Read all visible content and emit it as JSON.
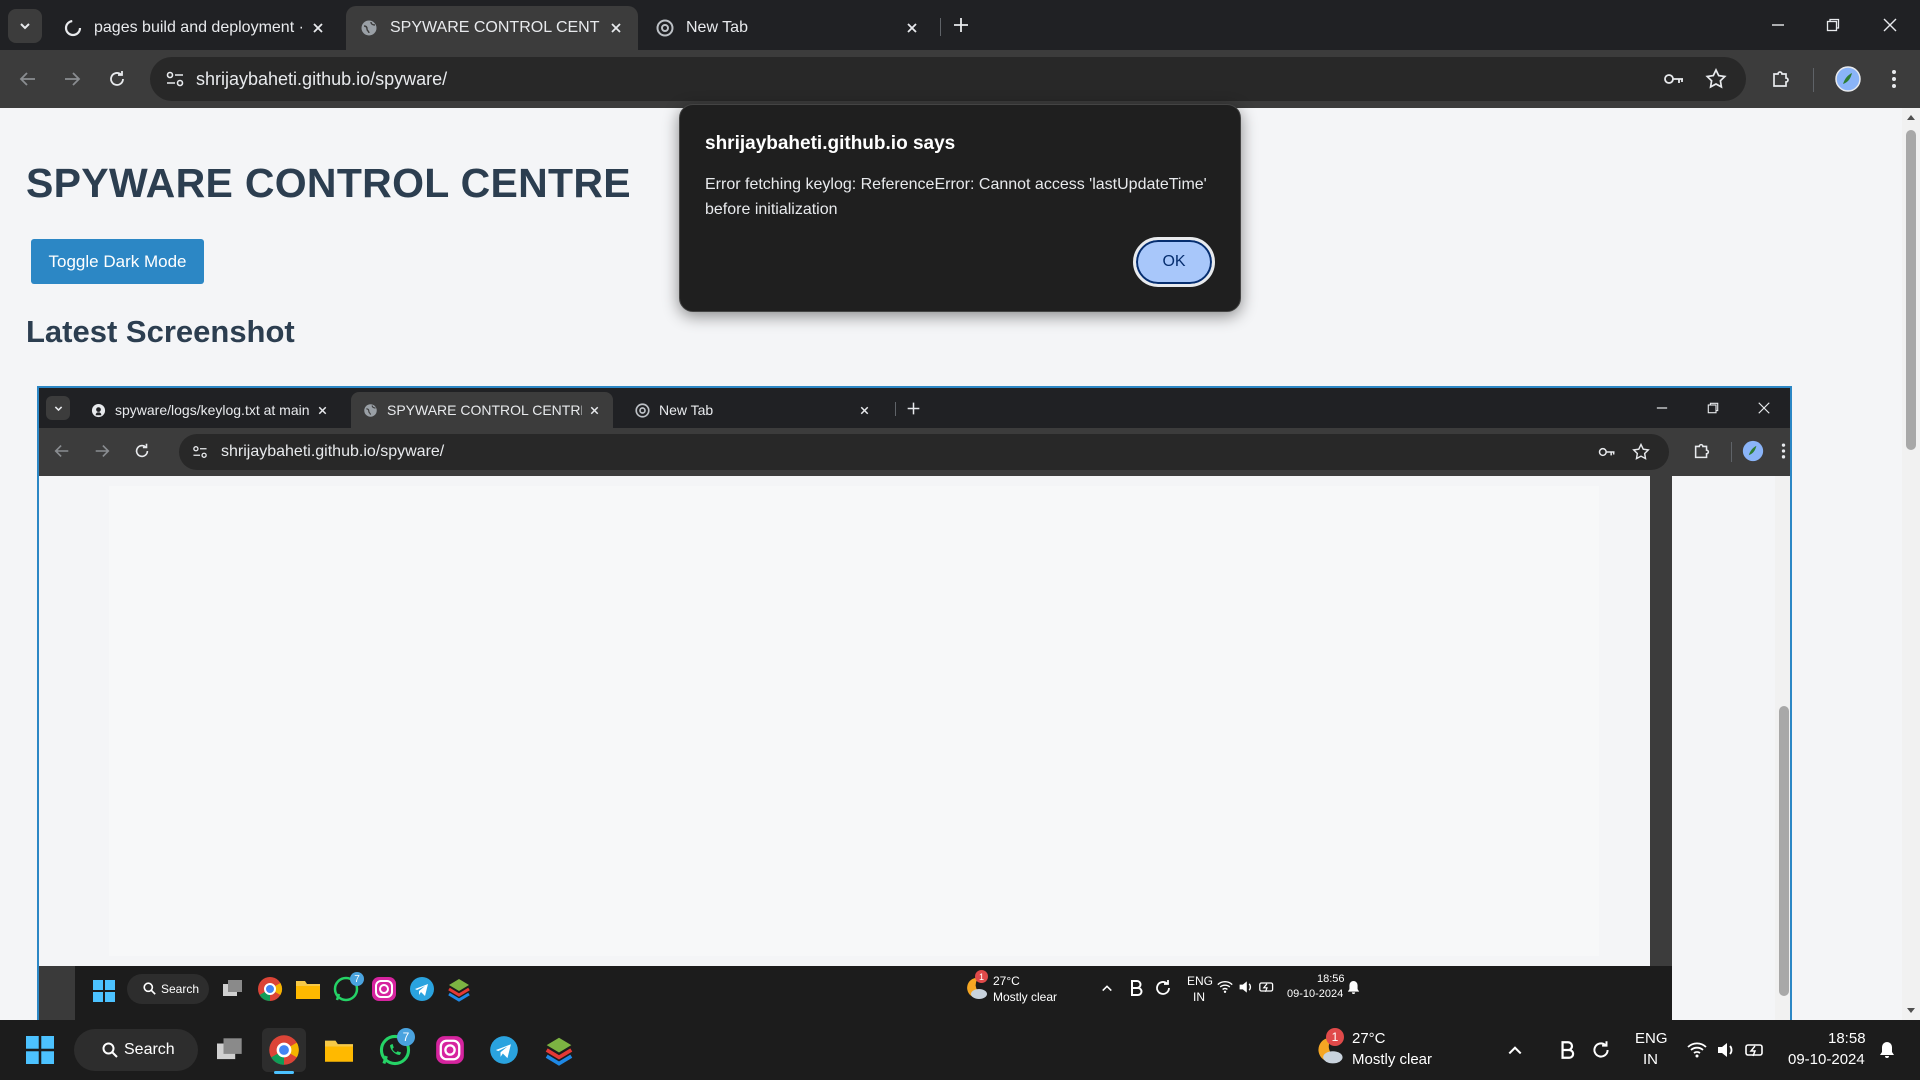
{
  "browser": {
    "tabs": [
      {
        "title": "pages build and deployment · s",
        "active": false
      },
      {
        "title": "SPYWARE CONTROL CENTRE",
        "active": true
      },
      {
        "title": "New Tab",
        "active": false
      }
    ],
    "url": "shrijaybaheti.github.io/spyware/"
  },
  "page": {
    "title": "SPYWARE CONTROL CENTRE",
    "toggle_button": "Toggle Dark Mode",
    "section_title": "Latest Screenshot"
  },
  "screenshot": {
    "tabs": [
      {
        "title": "spyware/logs/keylog.txt at main",
        "active": false
      },
      {
        "title": "SPYWARE CONTROL CENTRE",
        "active": true
      },
      {
        "title": "New Tab",
        "active": false
      }
    ],
    "url": "shrijaybaheti.github.io/spyware/",
    "taskbar": {
      "search": "Search",
      "weather_temp": "27°C",
      "weather_desc": "Mostly clear",
      "weather_badge": "1",
      "lang": "ENG",
      "region": "IN",
      "time": "18:56",
      "date": "09-10-2024",
      "whatsapp_badge": "7"
    }
  },
  "dialog": {
    "title": "shrijaybaheti.github.io says",
    "message": "Error fetching keylog: ReferenceError: Cannot access 'lastUpdateTime' before initialization",
    "ok": "OK"
  },
  "taskbar": {
    "search": "Search",
    "weather_temp": "27°C",
    "weather_desc": "Mostly clear",
    "weather_badge": "1",
    "lang": "ENG",
    "region": "IN",
    "time": "18:58",
    "date": "09-10-2024",
    "whatsapp_badge": "7"
  },
  "colors": {
    "accent": "#2c87c5",
    "heading": "#2c3e50",
    "dialog_bg": "#1f1f1f",
    "ok_button": "#a8c7fa"
  }
}
